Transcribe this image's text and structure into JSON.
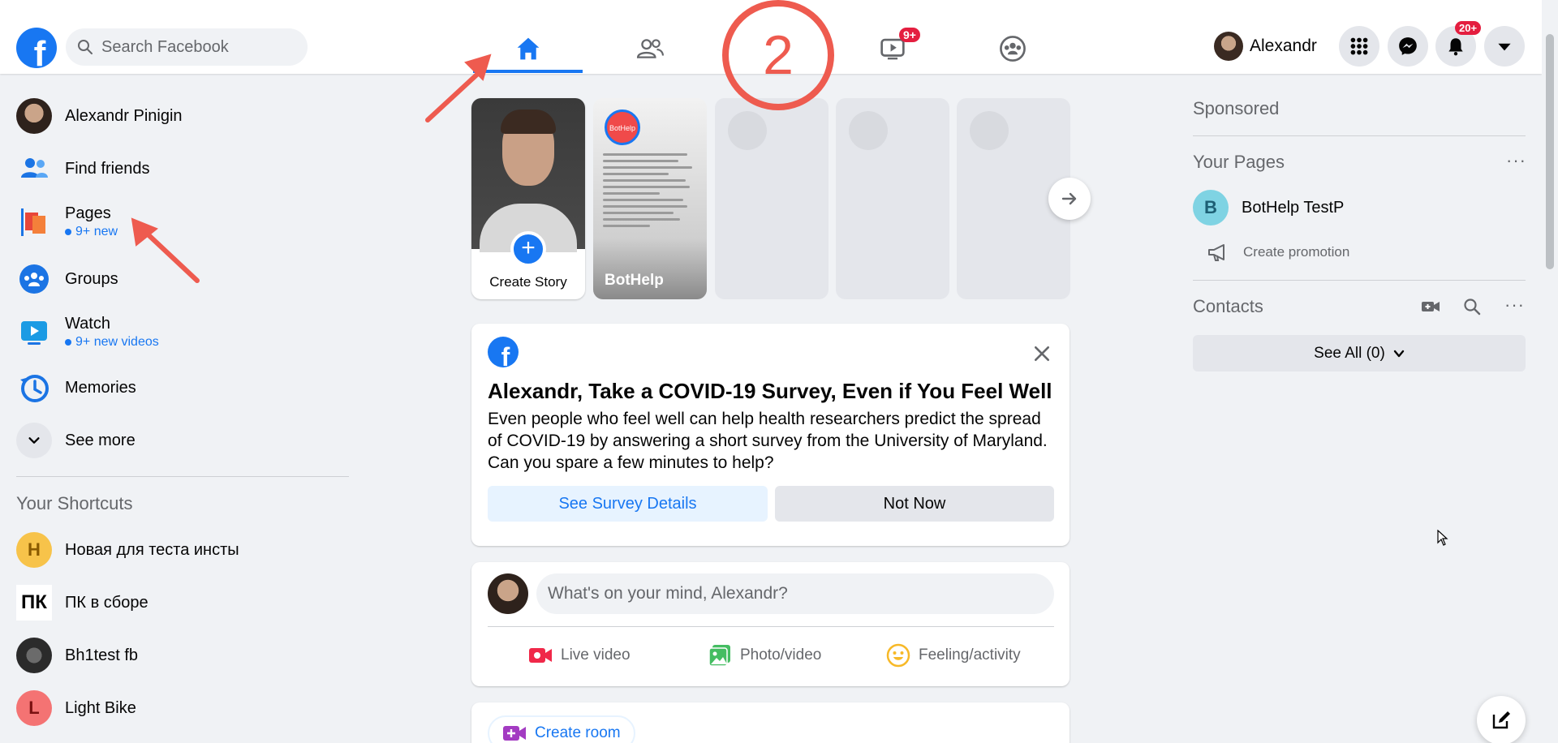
{
  "header": {
    "search_placeholder": "Search Facebook",
    "logo_letter": "f",
    "watch_badge": "9+",
    "notif_badge": "20+",
    "profile_name": "Alexandr"
  },
  "sidebar": {
    "items": [
      {
        "label": "Alexandr Pinigin",
        "icon": "avatar"
      },
      {
        "label": "Find friends",
        "icon": "friends-icon"
      },
      {
        "label": "Pages",
        "sub": "9+ new",
        "icon": "pages-flag-icon"
      },
      {
        "label": "Groups",
        "icon": "groups-icon"
      },
      {
        "label": "Watch",
        "sub": "9+ new videos",
        "icon": "watch-icon"
      },
      {
        "label": "Memories",
        "icon": "memories-clock-icon"
      },
      {
        "label": "See more",
        "icon": "chevron-down-icon"
      }
    ],
    "shortcuts_title": "Your Shortcuts",
    "shortcuts": [
      {
        "label": "Новая для теста инсты",
        "letter": "Н",
        "color": "#f7c34a"
      },
      {
        "label": "ПК в сборе",
        "letter": "ПК"
      },
      {
        "label": "Bh1test fb"
      },
      {
        "label": "Light Bike",
        "letter": "L",
        "color": "#f47373"
      }
    ]
  },
  "stories": {
    "create_label": "Create Story",
    "create_plus": "+",
    "bothelp_name": "BotHelp",
    "bothelp_logo": "BotHelp"
  },
  "survey": {
    "title": "Alexandr, Take a COVID-19 Survey, Even if You Feel Well",
    "body": "Even people who feel well can help health researchers predict the spread of COVID-19 by answering a short survey from the University of Maryland. Can you spare a few minutes to help?",
    "primary_button": "See Survey Details",
    "secondary_button": "Not Now"
  },
  "composer": {
    "placeholder": "What's on your mind, Alexandr?",
    "actions": [
      "Live video",
      "Photo/video",
      "Feeling/activity"
    ]
  },
  "room": {
    "label": "Create room"
  },
  "right": {
    "sponsored": "Sponsored",
    "your_pages": "Your Pages",
    "page_name": "BotHelp TestP",
    "page_letter": "B",
    "create_promotion": "Create promotion",
    "contacts": "Contacts",
    "see_all": "See All (0)",
    "more_dots": "···"
  },
  "annotation": {
    "step_number": "2",
    "color": "#ee5b4f"
  },
  "colors": {
    "brand": "#1877f2",
    "badge": "#e41e3f",
    "background": "#f0f2f5"
  }
}
